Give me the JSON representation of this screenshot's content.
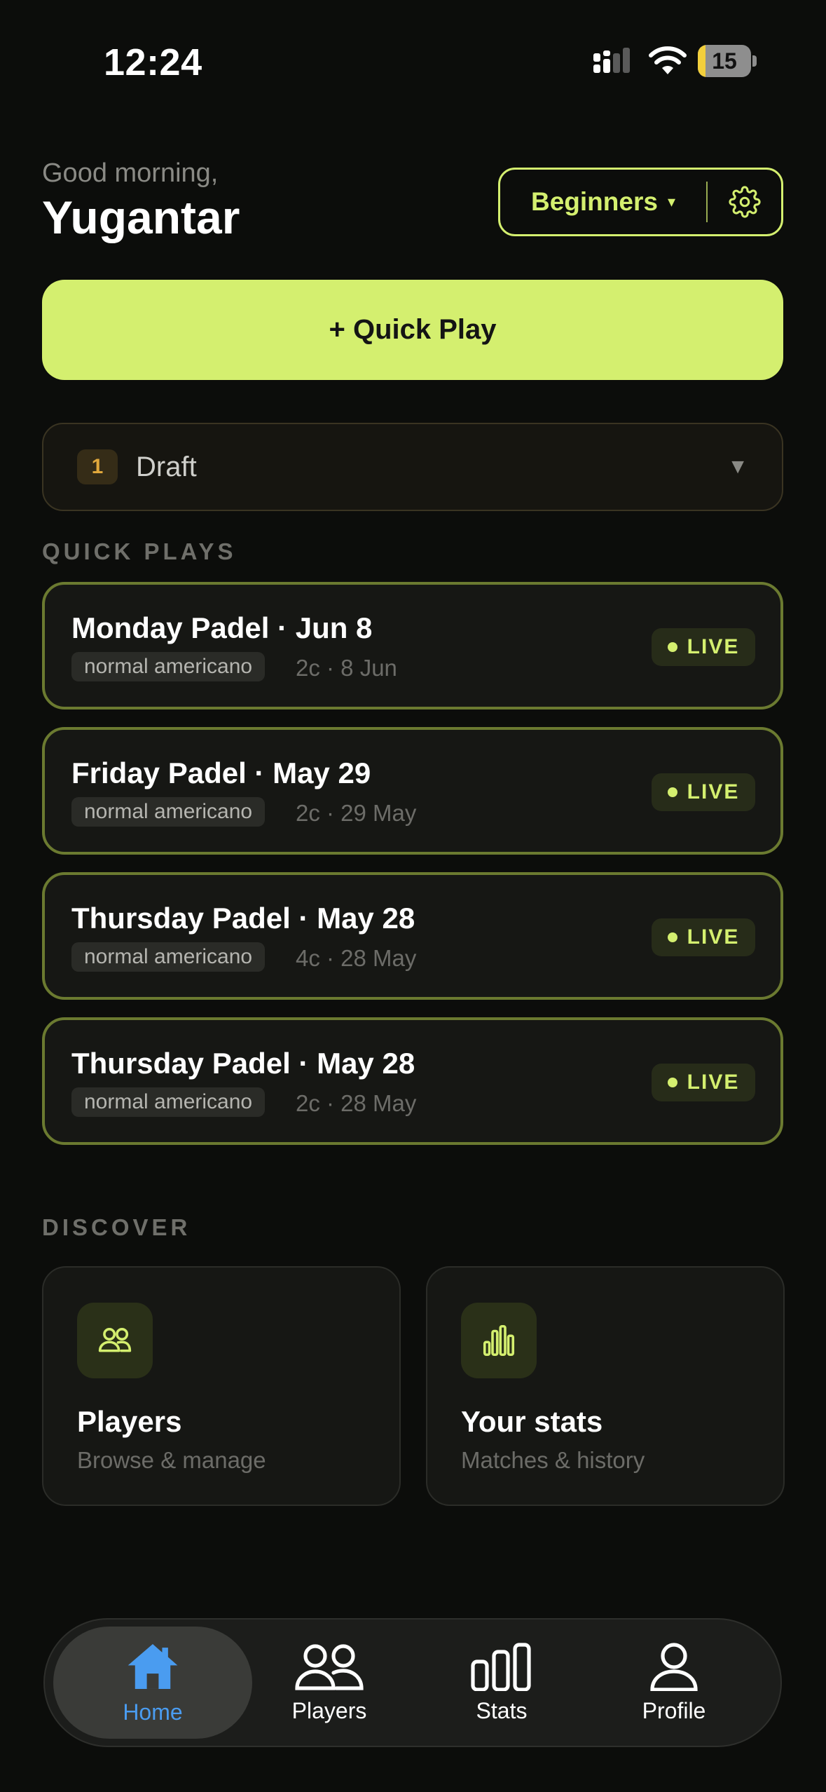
{
  "status_bar": {
    "time": "12:24",
    "battery": "15",
    "battery_level": 0.15
  },
  "header": {
    "greeting": "Good morning,",
    "username": "Yugantar",
    "group_selector": "Beginners",
    "caret": "▾"
  },
  "quick_play": {
    "label": "+ Quick Play"
  },
  "draft": {
    "count": "1",
    "label": "Draft",
    "caret": "▼"
  },
  "quick_plays": {
    "title": "QUICK PLAYS",
    "items": [
      {
        "title": "Monday Padel · Jun 8",
        "tag": "normal americano",
        "meta": "2c · 8 Jun",
        "status": "LIVE"
      },
      {
        "title": "Friday Padel · May 29",
        "tag": "normal americano",
        "meta": "2c · 29 May",
        "status": "LIVE"
      },
      {
        "title": "Thursday Padel · May 28",
        "tag": "normal americano",
        "meta": "4c · 28 May",
        "status": "LIVE"
      },
      {
        "title": "Thursday Padel · May 28",
        "tag": "normal americano",
        "meta": "2c · 28 May",
        "status": "LIVE"
      }
    ]
  },
  "discover": {
    "title": "DISCOVER",
    "cards": [
      {
        "title": "Players",
        "subtitle": "Browse & manage",
        "icon": "people-icon"
      },
      {
        "title": "Your stats",
        "subtitle": "Matches & history",
        "icon": "bar-chart-icon"
      }
    ]
  },
  "tabbar": {
    "tabs": [
      {
        "label": "Home",
        "icon": "house-icon",
        "active": true
      },
      {
        "label": "Players",
        "icon": "people-icon",
        "active": false
      },
      {
        "label": "Stats",
        "icon": "bar-chart-icon",
        "active": false
      },
      {
        "label": "Profile",
        "icon": "person-icon",
        "active": false
      }
    ]
  },
  "colors": {
    "background": "#0c0d0b",
    "accent": "#d4ef6f",
    "active_tab": "#4a9cf0",
    "draft_accent": "#e0a83c"
  }
}
